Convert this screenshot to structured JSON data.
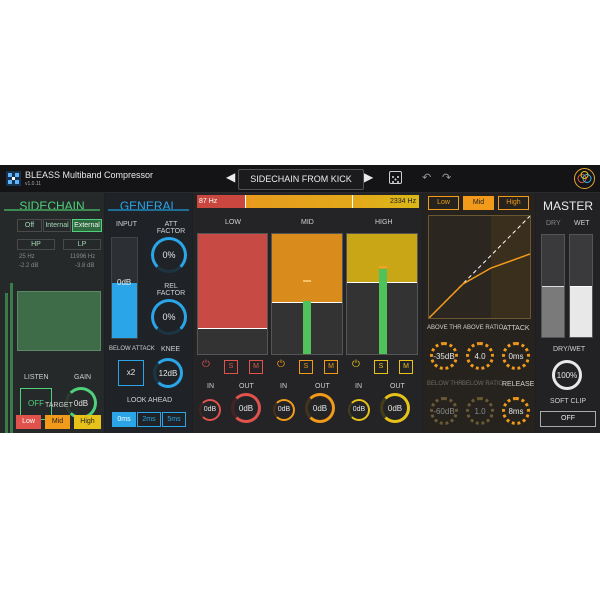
{
  "app": {
    "brand": "BLEASS Multiband Compressor",
    "version": "v1.0.11"
  },
  "preset": {
    "name": "SIDECHAIN FROM KICK"
  },
  "sidechain": {
    "title": "SIDECHAIN",
    "source_options": [
      "Off",
      "Internal",
      "External"
    ],
    "source_selected": "External",
    "hp_label": "HP",
    "lp_label": "LP",
    "hp_freq": "25 Hz",
    "hp_gain": "-2.2 dB",
    "lp_freq": "11996 Hz",
    "lp_gain": "-3.8 dB",
    "listen_label": "LISTEN",
    "listen_value": "OFF",
    "gain_label": "GAIN",
    "gain_value": "0dB",
    "target_label": "TARGET",
    "targets": [
      "Low",
      "Mid",
      "High"
    ]
  },
  "general": {
    "title": "GENERAL",
    "input_label": "INPUT",
    "input_value": "0dB",
    "att_factor_label": "ATT FACTOR",
    "att_factor_value": "0%",
    "rel_factor_label": "REL FACTOR",
    "rel_factor_value": "0%",
    "below_attack_label": "BELOW ATTACK",
    "below_attack_value": "x2",
    "knee_label": "KNEE",
    "knee_value": "12dB",
    "look_ahead_label": "LOOK AHEAD",
    "look_ahead_options": [
      "0ms",
      "2ms",
      "5ms"
    ],
    "look_ahead_selected": "0ms"
  },
  "bands": {
    "crossover_low": "87 Hz",
    "crossover_high": "2334 Hz",
    "items": [
      {
        "name": "LOW",
        "in_label": "IN",
        "out_label": "OUT",
        "in_value": "0dB",
        "out_value": "0dB",
        "solo": "S",
        "mute": "M",
        "color": "#e0524c"
      },
      {
        "name": "MID",
        "in_label": "IN",
        "out_label": "OUT",
        "in_value": "0dB",
        "out_value": "0dB",
        "solo": "S",
        "mute": "M",
        "color": "#f29a19"
      },
      {
        "name": "HIGH",
        "in_label": "IN",
        "out_label": "OUT",
        "in_value": "0dB",
        "out_value": "0dB",
        "solo": "S",
        "mute": "M",
        "color": "#e6c21a"
      }
    ]
  },
  "dynamics": {
    "tabs": [
      "Low",
      "Mid",
      "High"
    ],
    "tab_selected": "Mid",
    "above_thr_label": "ABOVE THR",
    "above_thr_value": "-35dB",
    "above_ratio_label": "ABOVE RATIO",
    "above_ratio_value": "4.0",
    "attack_label": "ATTACK",
    "attack_value": "0ms",
    "below_thr_label": "BELOW THR",
    "below_thr_value": "-60dB",
    "below_ratio_label": "BELOW RATIO",
    "below_ratio_value": "1.0",
    "release_label": "RELEASE",
    "release_value": "8ms"
  },
  "master": {
    "title": "MASTER",
    "dry_label": "DRY",
    "wet_label": "WET",
    "drywet_label": "DRY/WET",
    "drywet_value": "100%",
    "soft_clip_label": "SOFT CLIP",
    "soft_clip_value": "OFF"
  },
  "colors": {
    "sidechain": "#4fd07a",
    "general": "#2aa6e8",
    "low": "#e0524c",
    "mid": "#f29a19",
    "high": "#e6c21a"
  }
}
